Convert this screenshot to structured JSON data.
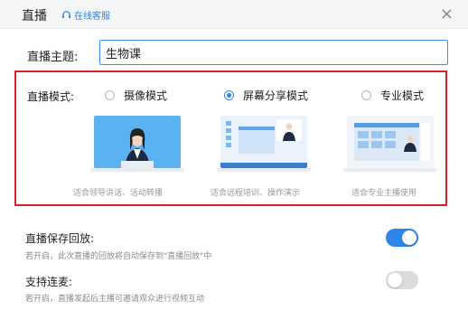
{
  "window": {
    "title": "直播",
    "service_link": "在线客服",
    "close_glyph": "×"
  },
  "topic": {
    "label": "直播主题:",
    "value": "生物课"
  },
  "mode": {
    "label": "直播模式:",
    "options": [
      {
        "label": "摄像模式",
        "desc": "适合领导讲话、活动转播",
        "selected": false
      },
      {
        "label": "屏幕分享模式",
        "desc": "适合远程培训、操作演示",
        "selected": true
      },
      {
        "label": "专业模式",
        "desc": "适合专业主播使用",
        "selected": false
      }
    ]
  },
  "settings": [
    {
      "title": "直播保存回放:",
      "desc": "若开启，此次直播的回放将自动保存到\"直播回放\"中",
      "enabled": true
    },
    {
      "title": "支持连麦:",
      "desc": "若开启，直播发起后主播可邀请观众进行视频互动",
      "enabled": false
    }
  ],
  "colors": {
    "accent": "#2e86e8",
    "highlight_border": "#d91e2a"
  }
}
